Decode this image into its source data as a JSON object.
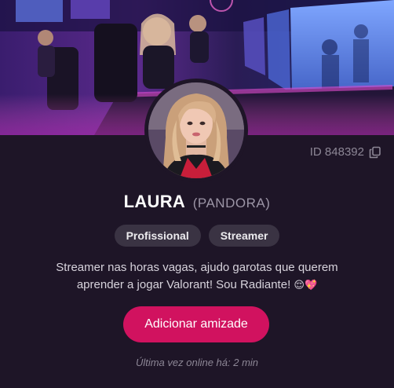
{
  "profile": {
    "name": "LAURA",
    "nickname": "(PANDORA)",
    "id_label": "ID 848392",
    "tags": [
      "Profissional",
      "Streamer"
    ],
    "bio_line1": "Streamer nas horas vagas, ajudo garotas que querem",
    "bio_line2": "aprender a jogar Valorant! Sou Radiante!",
    "bio_emojis": "😌💖",
    "add_friend_label": "Adicionar amizade",
    "last_online": "Última vez online há: 2 min"
  },
  "icons": {
    "copy": "copy-icon"
  },
  "colors": {
    "background": "#1e1527",
    "accent": "#d1125f",
    "tag_bg": "#3a3343",
    "muted_text": "#8d8796"
  }
}
